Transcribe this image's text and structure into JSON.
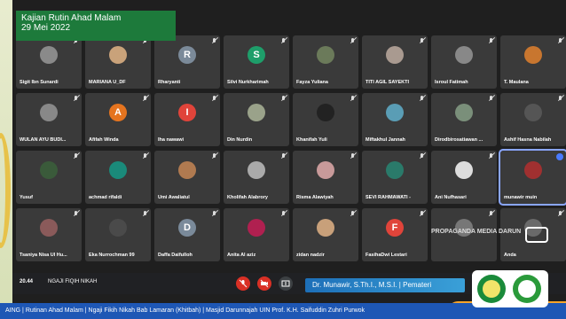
{
  "overlay": {
    "title_line1": "Kajian Rutin Ahad Malam",
    "title_line2": "29 Mei 2022",
    "presenter": "Dr. Munawir, S.Th.I., M.S.I. | Pemateri",
    "watermark": "PROPAGANDA MEDIA DARUN",
    "ticker": "AING | Rutinan Ahad Malam | Ngaji Fikih Nikah Bab Lamaran (Khitbah) | Masjid Darunnajah UIN Prof. K.H. Saifuddin Zuhri Purwok"
  },
  "meeting": {
    "time": "20.44",
    "name": "NGAJI FIQIH NIKAH"
  },
  "participants": [
    {
      "name": "Sigit Ibn Sunardi",
      "avatar": "",
      "color": "#8a8a8a"
    },
    {
      "name": "MARIANA U_DF",
      "avatar": "",
      "color": "#c9a27a"
    },
    {
      "name": "Rharyanti",
      "avatar": "R",
      "color": "#7b8a99"
    },
    {
      "name": "Silvi Nurkharimah",
      "avatar": "S",
      "color": "#1e9e6a"
    },
    {
      "name": "Fayza Yuliana",
      "avatar": "",
      "color": "#6b7a5a"
    },
    {
      "name": "TITI AGIL SAYEKTI",
      "avatar": "",
      "color": "#a99a90"
    },
    {
      "name": "Isroul Fatimah",
      "avatar": "",
      "color": "#888"
    },
    {
      "name": "T. Maulana",
      "avatar": "",
      "color": "#c8762f"
    },
    {
      "name": "WULAN AYU BUDI...",
      "avatar": "",
      "color": "#888"
    },
    {
      "name": "Afifah Winda",
      "avatar": "A",
      "color": "#e5741f"
    },
    {
      "name": "Iha nawawi",
      "avatar": "I",
      "color": "#e0443a"
    },
    {
      "name": "Din Nurdin",
      "avatar": "",
      "color": "#9aa28a"
    },
    {
      "name": "Khanifah Yuli",
      "avatar": "",
      "color": "#222"
    },
    {
      "name": "Miftakhul Jannah",
      "avatar": "",
      "color": "#5a9db5"
    },
    {
      "name": "Dirodbirosatiawan ...",
      "avatar": "",
      "color": "#7a8f7a"
    },
    {
      "name": "Ashif Hasna Nabilah",
      "avatar": "",
      "color": "#555"
    },
    {
      "name": "Yusuf",
      "avatar": "",
      "color": "#3a5a3a"
    },
    {
      "name": "achmad rifaldi",
      "avatar": "",
      "color": "#1a8a7a"
    },
    {
      "name": "Umi Awaliatul",
      "avatar": "",
      "color": "#b07a50"
    },
    {
      "name": "Kholifah Alabrory",
      "avatar": "",
      "color": "#aaa"
    },
    {
      "name": "Risma Alawiyah",
      "avatar": "",
      "color": "#c89a9a"
    },
    {
      "name": "SEVI RAHMAWATI -",
      "avatar": "",
      "color": "#2a7a6a"
    },
    {
      "name": "Ani Nufhasari",
      "avatar": "",
      "color": "#ddd"
    },
    {
      "name": "munawir muin",
      "avatar": "",
      "color": "#a03030"
    },
    {
      "name": "Tsaniya Nisa Ul Hu...",
      "avatar": "",
      "color": "#8a5a5a"
    },
    {
      "name": "Eka Nurrochman 99",
      "avatar": "",
      "color": "#4a4a4a"
    },
    {
      "name": "Daffa Daifulloh",
      "avatar": "D",
      "color": "#7a8a9a"
    },
    {
      "name": "Anita Al aziz",
      "avatar": "",
      "color": "#b02050"
    },
    {
      "name": "zidan nadzir",
      "avatar": "",
      "color": "#c8a07a"
    },
    {
      "name": "FasihaDwi Lestari",
      "avatar": "F",
      "color": "#e0443a"
    },
    {
      "name": "",
      "avatar": "",
      "color": "#777"
    },
    {
      "name": "Anda",
      "avatar": "",
      "color": "#6a6a6a"
    }
  ]
}
